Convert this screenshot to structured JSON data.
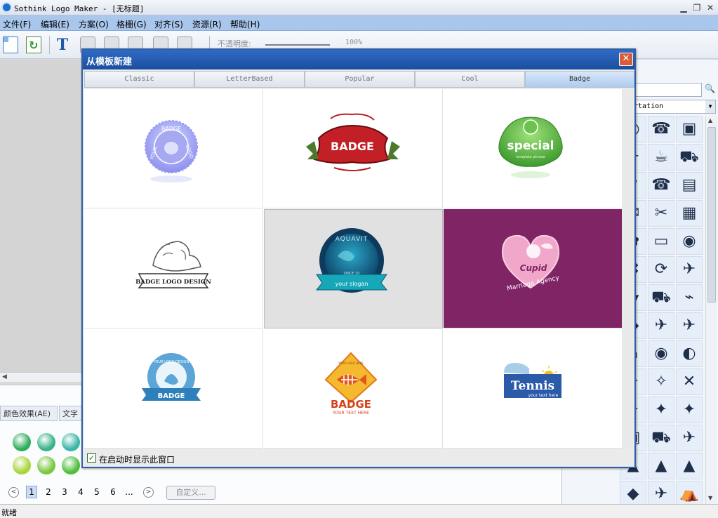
{
  "window": {
    "title": "Sothink Logo Maker - [无标题]",
    "min": "▁",
    "restore": "❐",
    "close": "✕"
  },
  "menu": [
    "文件(F)",
    "编辑(E)",
    "方案(O)",
    "格栅(G)",
    "对齐(S)",
    "资源(R)",
    "帮助(H)"
  ],
  "toolbar": {
    "opacity_label": "不透明度:",
    "opacity_value": "100%",
    "opacity_level": 1.0
  },
  "bottom_panel": {
    "tabs": [
      "颜色效果(AE)",
      "文字"
    ],
    "pages": [
      "1",
      "2",
      "3",
      "4",
      "5",
      "6",
      "..."
    ],
    "active_page": "1",
    "prev": "<",
    "next": ">",
    "custom_button": "自定义..."
  },
  "status": "就绪",
  "right_panel": {
    "combo_value": "rtation",
    "combo_arrow": "▼",
    "search_icon": "🔍"
  },
  "dialog": {
    "title": "从模板新建",
    "close": "✕",
    "tabs": [
      "Classic",
      "LetterBased",
      "Popular",
      "Cool",
      "Badge"
    ],
    "active_tab": "Badge",
    "templates": [
      {
        "name": "badge-seal",
        "texts": [
          "BADGE",
          "LOGO",
          "YOUR"
        ]
      },
      {
        "name": "badge-ribbon",
        "texts": [
          "BADGE"
        ]
      },
      {
        "name": "special-badge",
        "texts": [
          "special",
          "template phrase"
        ]
      },
      {
        "name": "lion-badge",
        "texts": [
          "BADGE LOGO DESIGN"
        ]
      },
      {
        "name": "aquavit-badge",
        "texts": [
          "AQUAVIT",
          "your slogan",
          "SINCE 20"
        ]
      },
      {
        "name": "cupid-badge",
        "texts": [
          "Cupid",
          "Marriage Agency"
        ]
      },
      {
        "name": "your-logo-design-badge",
        "texts": [
          "YOUR LOGO DESIGN",
          "BADGE"
        ]
      },
      {
        "name": "fish-badge",
        "texts": [
          "BADGE",
          "YOUR TEXT HERE",
          "YOUR LOGO HERE"
        ]
      },
      {
        "name": "tennis-badge",
        "texts": [
          "Tennis",
          "your text here"
        ]
      }
    ],
    "selected_template": "aquavit-badge",
    "startup_label": "在启动时显示此窗口",
    "startup_checked": true
  },
  "colors": {
    "accent": "#2f6ac4",
    "menu_bg": "#a9c6ec",
    "purple": "#7f2565",
    "badge_red": "#b81e24",
    "badge_green": "#4eae3a"
  }
}
